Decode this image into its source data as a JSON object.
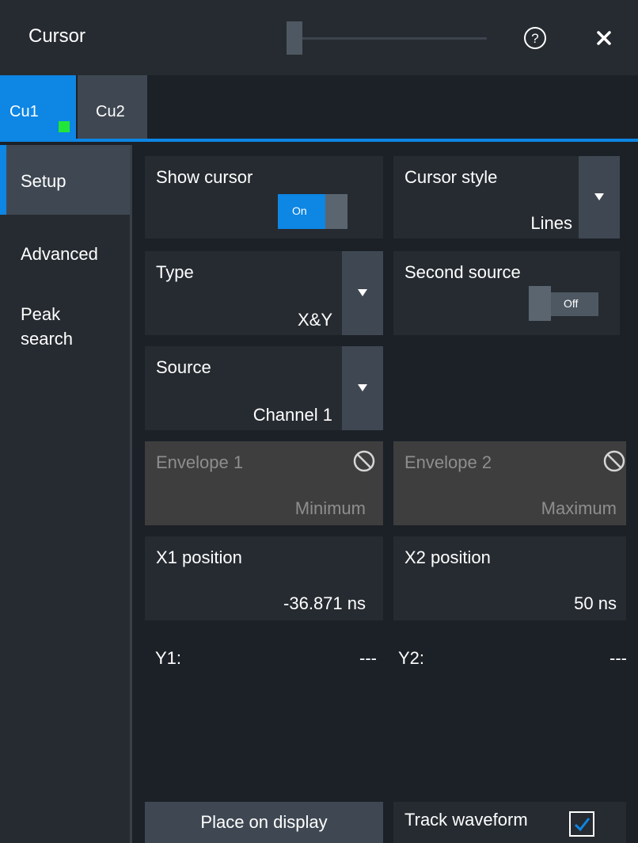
{
  "header": {
    "title": "Cursor",
    "help_icon": "help-circle-icon",
    "close_icon": "close-icon"
  },
  "tabs": [
    {
      "label": "Cu1",
      "active": true,
      "indicator_color": "#22e53a"
    },
    {
      "label": "Cu2",
      "active": false
    }
  ],
  "sidenav": {
    "items": [
      {
        "label": "Setup",
        "active": true
      },
      {
        "label": "Advanced",
        "active": false
      },
      {
        "label": "Peak\nsearch",
        "active": false
      }
    ]
  },
  "fields": {
    "show_cursor": {
      "label": "Show cursor",
      "toggle": "On",
      "state": true
    },
    "cursor_style": {
      "label": "Cursor style",
      "value": "Lines"
    },
    "type": {
      "label": "Type",
      "value": "X&Y"
    },
    "second_source": {
      "label": "Second source",
      "toggle": "Off",
      "state": false
    },
    "source": {
      "label": "Source",
      "value": "Channel 1"
    },
    "envelope1": {
      "label": "Envelope 1",
      "value": "Minimum",
      "disabled": true
    },
    "envelope2": {
      "label": "Envelope 2",
      "value": "Maximum",
      "disabled": true
    },
    "x1": {
      "label": "X1 position",
      "value": "-36.871 ns"
    },
    "x2": {
      "label": "X2 position",
      "value": "50 ns"
    }
  },
  "readouts": {
    "y1_label": "Y1:",
    "y1_value": "---",
    "y2_label": "Y2:",
    "y2_value": "---"
  },
  "buttons": {
    "place_on_display": "Place on display",
    "track_waveform": "Track waveform",
    "track_waveform_checked": true
  },
  "colors": {
    "accent": "#0d86e4",
    "background": "#1c2128",
    "panel": "#262b31",
    "active_tab_indicator": "#22e53a"
  }
}
